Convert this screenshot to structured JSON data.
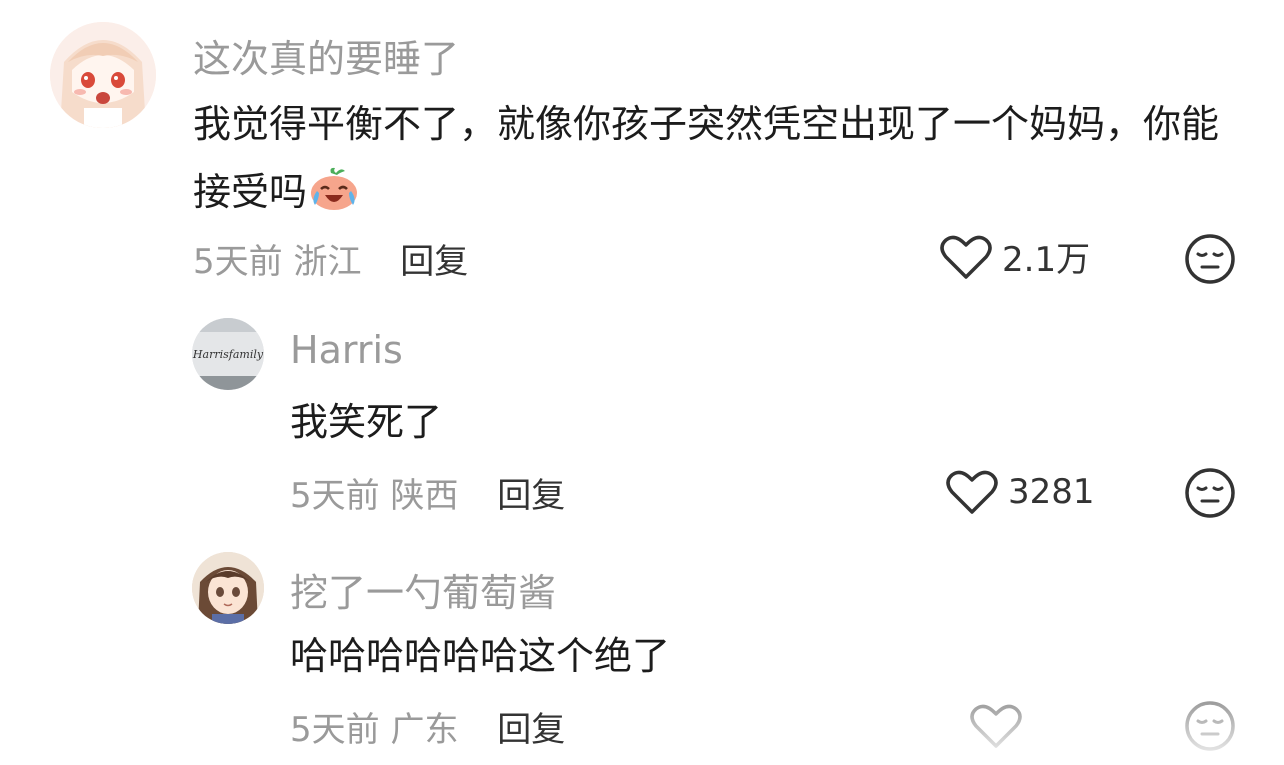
{
  "comments": [
    {
      "username": "这次真的要睡了",
      "content": "我觉得平衡不了，就像你孩子突然凭空出现了一个妈妈，你能接受吗",
      "emoji": "crying-laughing-emoji",
      "time": "5天前",
      "location": "浙江",
      "reply_label": "回复",
      "likes": "2.1万"
    },
    {
      "username": "Harris",
      "avatar_text": "Harrisfamily",
      "content": "我笑死了",
      "time": "5天前",
      "location": "陕西",
      "reply_label": "回复",
      "likes": "3281"
    },
    {
      "username": "挖了一勺葡萄酱",
      "content": "哈哈哈哈哈哈这个绝了",
      "time": "5天前",
      "location": "广东",
      "reply_label": "回复",
      "likes": ""
    }
  ],
  "colors": {
    "secondary_text": "#9a9a9a",
    "primary_text": "#1c1c1c",
    "icon": "#333333"
  }
}
